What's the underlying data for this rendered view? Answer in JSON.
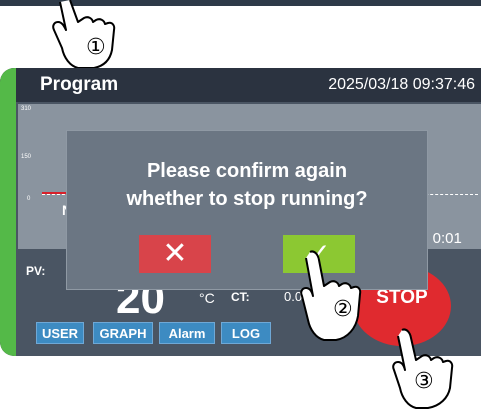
{
  "header": {
    "title": "Program",
    "datetime": "2025/03/18  09:37:46"
  },
  "graph": {
    "ticks": [
      "310",
      "150",
      "0"
    ],
    "partial_label": "N",
    "right_text": "g: 0:01"
  },
  "readout": {
    "pv_label": "PV:",
    "big_value": "20",
    "unit": "°C",
    "ct_label": "CT:",
    "ct_value": "0.0"
  },
  "stop": {
    "label": "STOP"
  },
  "nav": {
    "items": [
      "USER",
      "GRAPH",
      "Alarm",
      "LOG"
    ]
  },
  "dialog": {
    "line1": "Please confirm again",
    "line2": "whether to stop running?",
    "cancel_symbol": "✕",
    "confirm_symbol": "✓"
  },
  "steps": {
    "one": "①",
    "two": "②",
    "three": "③"
  },
  "colors": {
    "accent_green": "#8cc832",
    "danger_red": "#e02a2f",
    "nav_blue": "#3d8bc2"
  }
}
